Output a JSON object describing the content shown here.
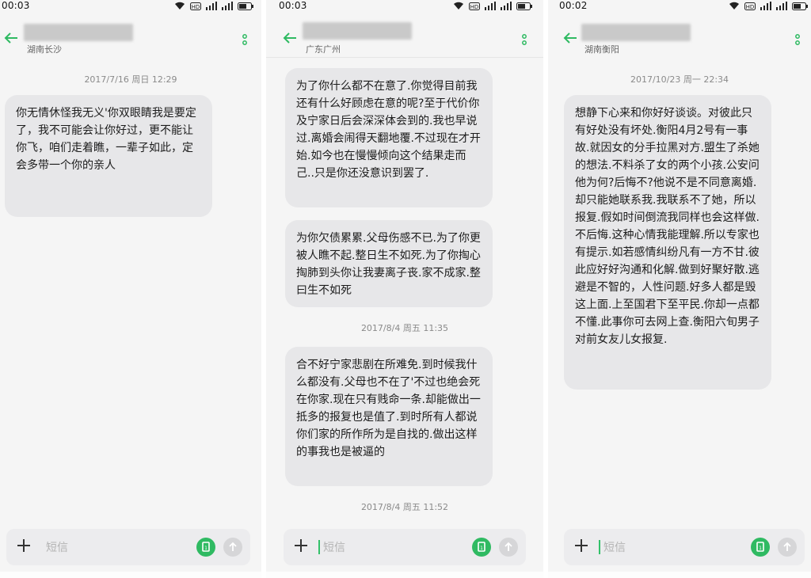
{
  "screens": [
    {
      "time": "00:03",
      "location": "湖南长沙",
      "placeholder": "短信",
      "stamps": [
        "2017/7/16 周日 12:29"
      ],
      "messages": [
        "你无情休怪我无义'你双眼睛我是要定了，我不可能会让你好过，更不能让你飞，咱们走着瞧，一辈子如此，定会多带一个你的亲人"
      ]
    },
    {
      "time": "00:03",
      "location": "广东广州",
      "placeholder": "短信",
      "stamps": [
        "2017/8/4 周五 11:35",
        "2017/8/4 周五 11:52"
      ],
      "messages": [
        "为了你什么都不在意了.你觉得目前我还有什么好顾虑在意的呢?至于代价你及宁家日后会深深体会到的.我也早说过.离婚会闹得天翻地覆.不过现在才开始.如今也在慢慢倾向这个结果走而己..只是你还没意识到罢了.",
        "为你欠债累累.父母伤感不已.为了你更被人瞧不起.整日生不如死.为了你掏心掏肺到头你让我妻离子丧.家不成家.整曰生不如死",
        "合不好宁家悲剧在所难免.到时候我什么都没有.父母也不在了'不过也绝会死在你家.现在只有贱命一条.却能做出一抵多的报复也是值了.到时所有人都说你们家的所作所为是自找的.做出这样的事我也是被逼的"
      ]
    },
    {
      "time": "00:02",
      "location": "湖南衡阳",
      "placeholder": "短信",
      "stamps": [
        "2017/10/23 周一 22:34"
      ],
      "messages": [
        "想静下心来和你好好谈谈。对彼此只有好处没有坏处.衡阳4月2号有一事故.就因女的分手拉黑对方.盟生了杀她的想法.不料杀了女的两个小孩.公安问他为何?后悔不?他说不是不同意离婚.却只能她联系我.我联系不了她，所以报复.假如时间倒流我同样也会这样做.不后悔.这种心情我能理解.所以专家也有提示.如若感情纠纷凡有一方不甘.彼此应好好沟通和化解.做到好聚好散.逃避是不智的，人性问题.好多人都是毁这上面.上至国君下至平民.你却一点都不懂.此事你可去网上查.衡阳六旬男子对前女友儿女报复."
      ]
    }
  ],
  "colors": {
    "accent": "#2fba62",
    "bubble": "#e7e7e9",
    "background": "#f5f5f5"
  },
  "icons": [
    "back-arrow-icon",
    "more-vertical-icon",
    "wifi-icon",
    "hd-icon",
    "signal-icon",
    "battery-icon",
    "plus-icon",
    "sim-icon",
    "send-arrow-icon"
  ]
}
